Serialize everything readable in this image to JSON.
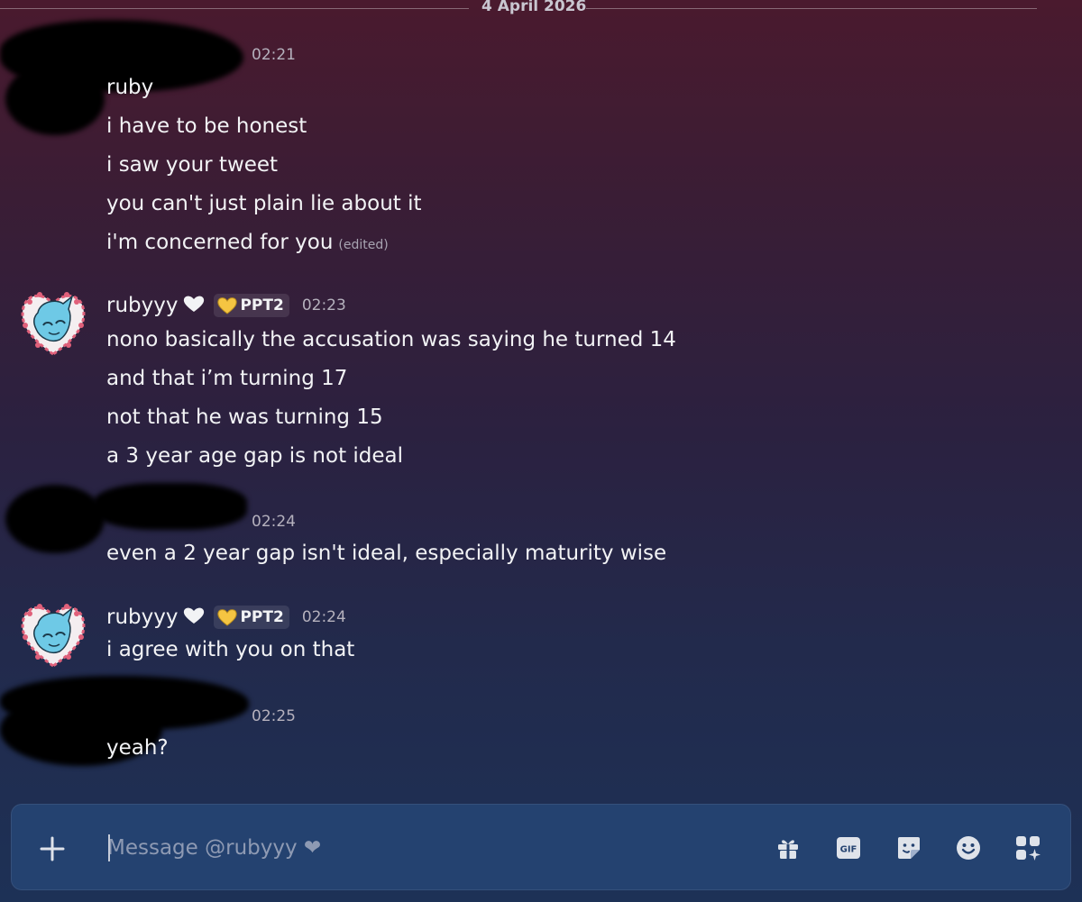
{
  "date_divider": "4 April 2026",
  "messages": [
    {
      "timestamp": "02:21",
      "lines": [
        "ruby",
        "i have to be honest",
        "i saw your tweet",
        "you can't just plain lie about it",
        "i'm concerned for you"
      ],
      "edited_label": "(edited)"
    },
    {
      "username": "rubyyy",
      "tag": "PPT2",
      "timestamp": "02:23",
      "lines": [
        "nono basically the accusation was saying he turned 14",
        "and that i’m turning 17",
        "not that he was turning 15",
        "a 3 year age gap is not ideal"
      ]
    },
    {
      "timestamp": "02:24",
      "lines": [
        "even a 2 year gap isn't ideal, especially maturity wise"
      ]
    },
    {
      "username": "rubyyy",
      "tag": "PPT2",
      "timestamp": "02:24",
      "lines": [
        "i agree with you on that"
      ]
    },
    {
      "timestamp": "02:25",
      "lines": [
        "yeah?"
      ]
    }
  ],
  "composer": {
    "placeholder": "Message @rubyyy ❤",
    "value": "",
    "buttons": [
      "plus-icon",
      "gift-icon",
      "gif-icon",
      "sticker-icon",
      "emoji-icon",
      "apps-icon"
    ]
  },
  "colors": {
    "heart": "#f2f3f5",
    "tag_heart": "#f5c542",
    "composer_bg": "#244270"
  }
}
